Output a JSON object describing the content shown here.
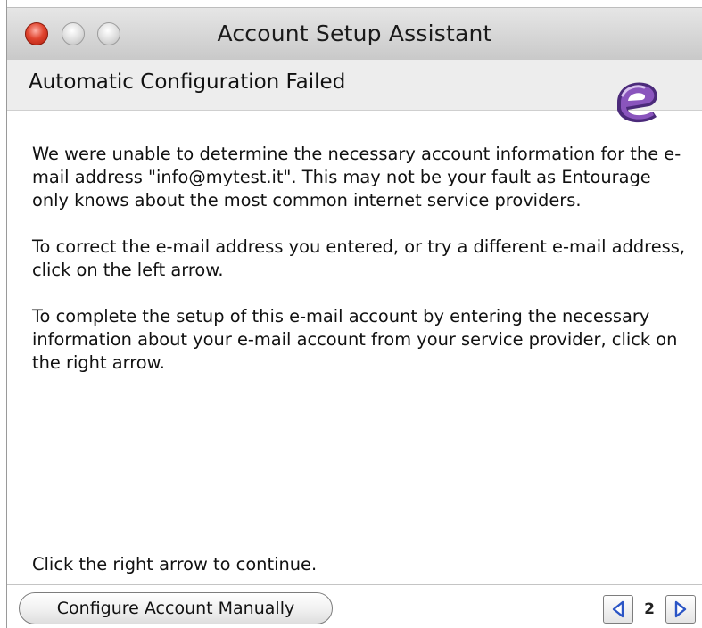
{
  "window": {
    "title": "Account Setup Assistant"
  },
  "header": {
    "title": "Automatic Configuration Failed",
    "logo_icon": "entourage-logo-icon"
  },
  "body": {
    "paragraphs": [
      "We were unable to determine the necessary account information for the e-mail address \"info@mytest.it\". This may not be your fault as Entourage only knows about the most common internet service providers.",
      "To correct the e-mail address you entered, or try a different e-mail address, click on the left arrow.",
      "To complete the setup of this e-mail account by entering the necessary information about your e-mail account from your service provider, click on the right arrow."
    ],
    "continue_text": "Click the right arrow to continue."
  },
  "footer": {
    "configure_label": "Configure Account Manually",
    "page_number": "2",
    "prev_icon": "left-arrow-icon",
    "next_icon": "right-arrow-icon"
  },
  "colors": {
    "arrow": "#2b55c5",
    "logo_purple": "#7b4aa6",
    "close_button": "#e0452f"
  }
}
